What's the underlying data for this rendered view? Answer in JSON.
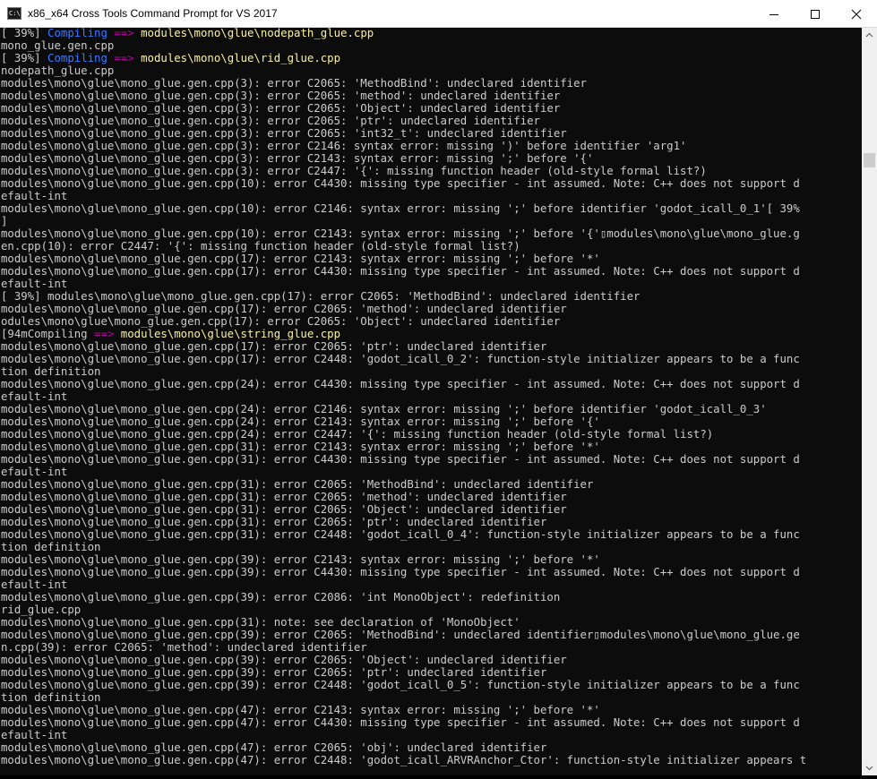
{
  "window": {
    "title": "x86_x64 Cross Tools Command Prompt for VS 2017"
  },
  "console": {
    "lines": [
      [
        {
          "t": "[ 39%] "
        },
        {
          "t": "Compiling",
          "c": "blue"
        },
        {
          "t": " "
        },
        {
          "t": "==>",
          "c": "arrow"
        },
        {
          "t": " "
        },
        {
          "t": "modules\\mono\\glue\\nodepath_glue.cpp",
          "c": "path"
        }
      ],
      [
        {
          "t": "mono_glue.gen.cpp"
        }
      ],
      [
        {
          "t": "[ 39%] "
        },
        {
          "t": "Compiling",
          "c": "blue"
        },
        {
          "t": " "
        },
        {
          "t": "==>",
          "c": "arrow"
        },
        {
          "t": " "
        },
        {
          "t": "modules\\mono\\glue\\rid_glue.cpp",
          "c": "path"
        }
      ],
      [
        {
          "t": "nodepath_glue.cpp"
        }
      ],
      [
        {
          "t": "modules\\mono\\glue\\mono_glue.gen.cpp(3): error C2065: 'MethodBind': undeclared identifier"
        }
      ],
      [
        {
          "t": "modules\\mono\\glue\\mono_glue.gen.cpp(3): error C2065: 'method': undeclared identifier"
        }
      ],
      [
        {
          "t": "modules\\mono\\glue\\mono_glue.gen.cpp(3): error C2065: 'Object': undeclared identifier"
        }
      ],
      [
        {
          "t": "modules\\mono\\glue\\mono_glue.gen.cpp(3): error C2065: 'ptr': undeclared identifier"
        }
      ],
      [
        {
          "t": "modules\\mono\\glue\\mono_glue.gen.cpp(3): error C2065: 'int32_t': undeclared identifier"
        }
      ],
      [
        {
          "t": "modules\\mono\\glue\\mono_glue.gen.cpp(3): error C2146: syntax error: missing ')' before identifier 'arg1'"
        }
      ],
      [
        {
          "t": "modules\\mono\\glue\\mono_glue.gen.cpp(3): error C2143: syntax error: missing ';' before '{'"
        }
      ],
      [
        {
          "t": "modules\\mono\\glue\\mono_glue.gen.cpp(3): error C2447: '{': missing function header (old-style formal list?)"
        }
      ],
      [
        {
          "t": "modules\\mono\\glue\\mono_glue.gen.cpp(10): error C4430: missing type specifier - int assumed. Note: C++ does not support d"
        }
      ],
      [
        {
          "t": "efault-int"
        }
      ],
      [
        {
          "t": "modules\\mono\\glue\\mono_glue.gen.cpp(10): error C2146: syntax error: missing ';' before identifier 'godot_icall_0_1'[ 39%"
        }
      ],
      [
        {
          "t": "]"
        }
      ],
      [
        {
          "t": "modules\\mono\\glue\\mono_glue.gen.cpp(10): error C2143: syntax error: missing ';' before '{'▯modules\\mono\\glue\\mono_glue.g"
        }
      ],
      [
        {
          "t": "en.cpp(10): error C2447: '{': missing function header (old-style formal list?)"
        }
      ],
      [
        {
          "t": "modules\\mono\\glue\\mono_glue.gen.cpp(17): error C2143: syntax error: missing ';' before '*'"
        }
      ],
      [
        {
          "t": "modules\\mono\\glue\\mono_glue.gen.cpp(17): error C4430: missing type specifier - int assumed. Note: C++ does not support d"
        }
      ],
      [
        {
          "t": "efault-int"
        }
      ],
      [
        {
          "t": "[ 39%] modules\\mono\\glue\\mono_glue.gen.cpp(17): error C2065: 'MethodBind': undeclared identifier"
        }
      ],
      [
        {
          "t": "modules\\mono\\glue\\mono_glue.gen.cpp(17): error C2065: 'method': undeclared identifier"
        }
      ],
      [
        {
          "t": "odules\\mono\\glue\\mono_glue.gen.cpp(17): error C2065: 'Object': undeclared identifier"
        }
      ],
      [
        {
          "t": "[94mCompiling "
        },
        {
          "t": "==>",
          "c": "arrow"
        },
        {
          "t": " "
        },
        {
          "t": "modules\\mono\\glue\\string_glue.cpp",
          "c": "path"
        }
      ],
      [
        {
          "t": "modules\\mono\\glue\\mono_glue.gen.cpp(17): error C2065: 'ptr': undeclared identifier"
        }
      ],
      [
        {
          "t": "modules\\mono\\glue\\mono_glue.gen.cpp(17): error C2448: 'godot_icall_0_2': function-style initializer appears to be a func"
        }
      ],
      [
        {
          "t": "tion definition"
        }
      ],
      [
        {
          "t": "modules\\mono\\glue\\mono_glue.gen.cpp(24): error C4430: missing type specifier - int assumed. Note: C++ does not support d"
        }
      ],
      [
        {
          "t": "efault-int"
        }
      ],
      [
        {
          "t": "modules\\mono\\glue\\mono_glue.gen.cpp(24): error C2146: syntax error: missing ';' before identifier 'godot_icall_0_3'"
        }
      ],
      [
        {
          "t": "modules\\mono\\glue\\mono_glue.gen.cpp(24): error C2143: syntax error: missing ';' before '{'"
        }
      ],
      [
        {
          "t": "modules\\mono\\glue\\mono_glue.gen.cpp(24): error C2447: '{': missing function header (old-style formal list?)"
        }
      ],
      [
        {
          "t": "modules\\mono\\glue\\mono_glue.gen.cpp(31): error C2143: syntax error: missing ';' before '*'"
        }
      ],
      [
        {
          "t": "modules\\mono\\glue\\mono_glue.gen.cpp(31): error C4430: missing type specifier - int assumed. Note: C++ does not support d"
        }
      ],
      [
        {
          "t": "efault-int"
        }
      ],
      [
        {
          "t": "modules\\mono\\glue\\mono_glue.gen.cpp(31): error C2065: 'MethodBind': undeclared identifier"
        }
      ],
      [
        {
          "t": "modules\\mono\\glue\\mono_glue.gen.cpp(31): error C2065: 'method': undeclared identifier"
        }
      ],
      [
        {
          "t": "modules\\mono\\glue\\mono_glue.gen.cpp(31): error C2065: 'Object': undeclared identifier"
        }
      ],
      [
        {
          "t": "modules\\mono\\glue\\mono_glue.gen.cpp(31): error C2065: 'ptr': undeclared identifier"
        }
      ],
      [
        {
          "t": "modules\\mono\\glue\\mono_glue.gen.cpp(31): error C2448: 'godot_icall_0_4': function-style initializer appears to be a func"
        }
      ],
      [
        {
          "t": "tion definition"
        }
      ],
      [
        {
          "t": "modules\\mono\\glue\\mono_glue.gen.cpp(39): error C2143: syntax error: missing ';' before '*'"
        }
      ],
      [
        {
          "t": "modules\\mono\\glue\\mono_glue.gen.cpp(39): error C4430: missing type specifier - int assumed. Note: C++ does not support d"
        }
      ],
      [
        {
          "t": "efault-int"
        }
      ],
      [
        {
          "t": "modules\\mono\\glue\\mono_glue.gen.cpp(39): error C2086: 'int MonoObject': redefinition"
        }
      ],
      [
        {
          "t": "rid_glue.cpp"
        }
      ],
      [
        {
          "t": "modules\\mono\\glue\\mono_glue.gen.cpp(31): note: see declaration of 'MonoObject'"
        }
      ],
      [
        {
          "t": "modules\\mono\\glue\\mono_glue.gen.cpp(39): error C2065: 'MethodBind': undeclared identifier▯modules\\mono\\glue\\mono_glue.ge"
        }
      ],
      [
        {
          "t": "n.cpp(39): error C2065: 'method': undeclared identifier"
        }
      ],
      [
        {
          "t": "modules\\mono\\glue\\mono_glue.gen.cpp(39): error C2065: 'Object': undeclared identifier"
        }
      ],
      [
        {
          "t": "modules\\mono\\glue\\mono_glue.gen.cpp(39): error C2065: 'ptr': undeclared identifier"
        }
      ],
      [
        {
          "t": "modules\\mono\\glue\\mono_glue.gen.cpp(39): error C2448: 'godot_icall_0_5': function-style initializer appears to be a func"
        }
      ],
      [
        {
          "t": "tion definition"
        }
      ],
      [
        {
          "t": "modules\\mono\\glue\\mono_glue.gen.cpp(47): error C2143: syntax error: missing ';' before '*'"
        }
      ],
      [
        {
          "t": "modules\\mono\\glue\\mono_glue.gen.cpp(47): error C4430: missing type specifier - int assumed. Note: C++ does not support d"
        }
      ],
      [
        {
          "t": "efault-int"
        }
      ],
      [
        {
          "t": "modules\\mono\\glue\\mono_glue.gen.cpp(47): error C2065: 'obj': undeclared identifier"
        }
      ],
      [
        {
          "t": "modules\\mono\\glue\\mono_glue.gen.cpp(47): error C2448: 'godot_icall_ARVRAnchor_Ctor': function-style initializer appears t"
        }
      ]
    ]
  },
  "icons": {
    "app": "console-app-icon",
    "minimize": "minimize-icon",
    "maximize": "maximize-icon",
    "close": "close-icon",
    "scroll_up": "scroll-up-arrow-icon",
    "scroll_down": "scroll-down-arrow-icon"
  },
  "colors": {
    "background": "#0c0c0c",
    "text": "#cccccc",
    "path": "#f9f1a5",
    "arrow": "#b4009e",
    "compiling": "#3b78ff"
  }
}
